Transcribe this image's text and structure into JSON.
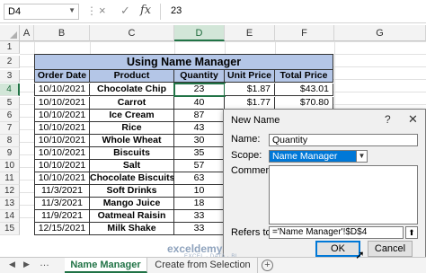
{
  "formula_bar": {
    "name_box": "D4",
    "cancel_icon": "×",
    "enter_icon": "✓",
    "fx_label": "fx",
    "value": "23"
  },
  "columns": [
    "A",
    "B",
    "C",
    "D",
    "E",
    "F",
    "G"
  ],
  "rows": [
    "1",
    "2",
    "3",
    "4",
    "5",
    "6",
    "7",
    "8",
    "9",
    "10",
    "11",
    "12",
    "13",
    "14",
    "15"
  ],
  "table": {
    "title": "Using Name Manager",
    "headers": [
      "Order Date",
      "Product",
      "Quantity",
      "Unit Price",
      "Total Price"
    ],
    "rows": [
      [
        "10/10/2021",
        "Chocolate Chip",
        "23",
        "$1.87",
        "$43.01"
      ],
      [
        "10/10/2021",
        "Carrot",
        "40",
        "$1.77",
        "$70.80"
      ],
      [
        "10/10/2021",
        "Ice Cream",
        "87",
        "",
        ""
      ],
      [
        "10/10/2021",
        "Rice",
        "43",
        "",
        ""
      ],
      [
        "10/10/2021",
        "Whole Wheat",
        "30",
        "",
        ""
      ],
      [
        "10/10/2021",
        "Biscuits",
        "35",
        "",
        ""
      ],
      [
        "10/10/2021",
        "Salt",
        "57",
        "",
        ""
      ],
      [
        "10/10/2021",
        "Chocolate Biscuits",
        "63",
        "",
        ""
      ],
      [
        "11/3/2021",
        "Soft Drinks",
        "10",
        "",
        ""
      ],
      [
        "11/3/2021",
        "Mango Juice",
        "18",
        "",
        ""
      ],
      [
        "11/9/2021",
        "Oatmeal Raisin",
        "33",
        "",
        ""
      ],
      [
        "12/15/2021",
        "Milk Shake",
        "33",
        "",
        ""
      ]
    ]
  },
  "dialog": {
    "title": "New Name",
    "help": "?",
    "close": "✕",
    "name_label": "Name:",
    "name_value": "Quantity",
    "scope_label": "Scope:",
    "scope_value": "Name Manager",
    "comment_label": "Comment:",
    "refers_label": "Refers to:",
    "refers_value": "='Name Manager'!$D$4",
    "ok_label": "OK",
    "cancel_label": "Cancel"
  },
  "sheet_tabs": {
    "tabs": [
      "Name Manager",
      "Create from Selection"
    ],
    "active": "Name Manager",
    "add": "+"
  },
  "watermark": {
    "text": "exceldemy",
    "sub": "EXCEL · DATA · BI"
  },
  "colors": {
    "header_fill": "#b4c6e7",
    "excel_green": "#217346",
    "arrow": "#f39a1d",
    "selection_blue": "#0078d7"
  }
}
